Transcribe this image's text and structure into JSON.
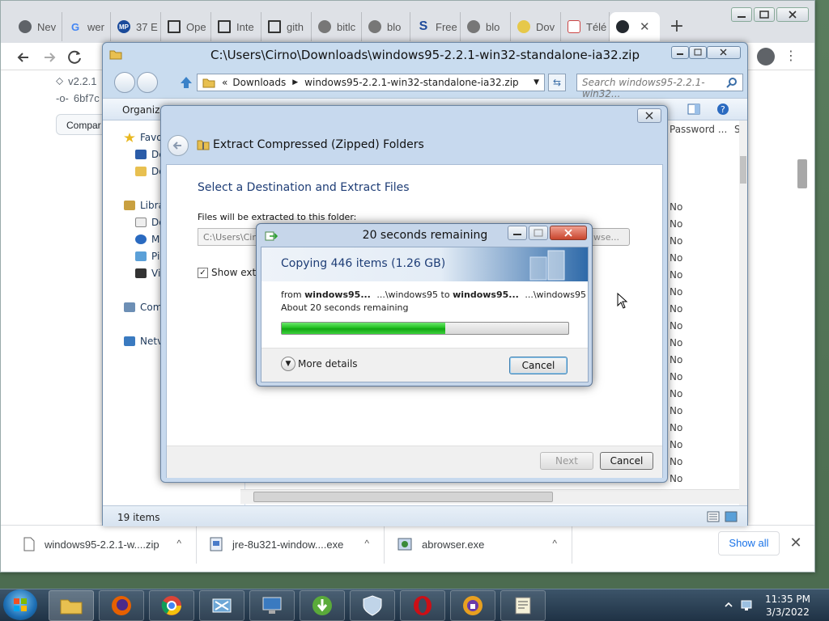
{
  "browser": {
    "tabs": [
      {
        "label": "Nev",
        "icon": "chrome-icon"
      },
      {
        "label": "wer",
        "icon": "google-icon"
      },
      {
        "label": "37 E",
        "icon": "mp-icon"
      },
      {
        "label": "Ope",
        "icon": "museum-icon"
      },
      {
        "label": "Inte",
        "icon": "museum-icon"
      },
      {
        "label": "gith",
        "icon": "museum-icon"
      },
      {
        "label": "bitlc",
        "icon": "globe-icon"
      },
      {
        "label": "blo",
        "icon": "globe-icon"
      },
      {
        "label": "Free",
        "icon": "s-icon"
      },
      {
        "label": "blo",
        "icon": "globe-icon"
      },
      {
        "label": "Dov",
        "icon": "flower-icon"
      },
      {
        "label": "Télé",
        "icon": "doc-icon"
      }
    ],
    "new_tab": "+",
    "github": {
      "tag": "v2.2.1",
      "commit": "6bf7c",
      "compare": "Compar"
    }
  },
  "downloads": {
    "items": [
      {
        "name": "windows95-2.2.1-w....zip"
      },
      {
        "name": "jre-8u321-window....exe"
      },
      {
        "name": "abrowser.exe"
      }
    ],
    "show_all": "Show all"
  },
  "explorer": {
    "title": "C:\\Users\\Cirno\\Downloads\\windows95-2.2.1-win32-standalone-ia32.zip",
    "breadcrumb": [
      "«",
      "Downloads",
      "windows95-2.2.1-win32-standalone-ia32.zip"
    ],
    "search_placeholder": "Search windows95-2.2.1-win32...",
    "organize": "Organize",
    "nav": {
      "favorites": "Favo",
      "desktop": "De",
      "downloads": "Do",
      "libraries": "Libra",
      "documents": "Do",
      "music": "Mu",
      "pictures": "Pic",
      "videos": "Vid",
      "computer": "Com",
      "network": "Netv"
    },
    "columns": {
      "password": "Password ...",
      "size": "Si"
    },
    "password_values": [
      "No",
      "No",
      "No",
      "No",
      "No",
      "No",
      "No",
      "No",
      "No",
      "No",
      "No",
      "No",
      "No",
      "No",
      "No",
      "No",
      "No"
    ],
    "status": "19 items"
  },
  "wizard": {
    "title": "Extract Compressed (Zipped) Folders",
    "heading": "Select a Destination and Extract Files",
    "dest_label": "Files will be extracted to this folder:",
    "dest_value": "C:\\Users\\Cirn",
    "browse": "wse...",
    "show_label": "Show extra",
    "next": "Next",
    "cancel": "Cancel"
  },
  "copy": {
    "title": "20 seconds remaining",
    "heading": "Copying 446 items (1.26 GB)",
    "from_word": "from",
    "from_name": "windows95...",
    "from_path": "...\\windows95",
    "to_word": "to",
    "to_name": "windows95...",
    "to_path": "...\\windows95",
    "remaining": "About 20 seconds remaining",
    "progress": 0.57,
    "more_details": "More details",
    "cancel": "Cancel"
  },
  "taskbar": {
    "time": "11:35 PM",
    "date": "3/3/2022"
  },
  "colors": {
    "progress_green": "#22c022",
    "explorer_frame": "#c9dcef",
    "chrome_tabstrip": "#dee1e6",
    "link_blue": "#1a73e8"
  }
}
